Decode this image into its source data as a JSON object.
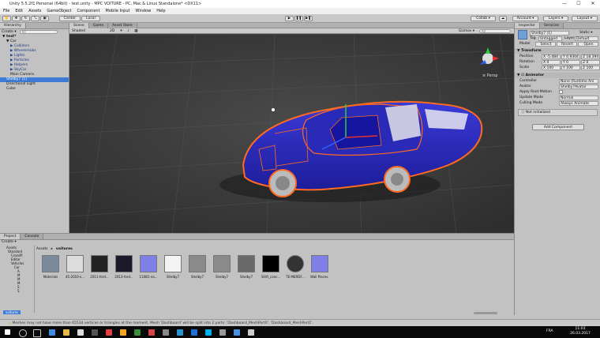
{
  "window": {
    "title": "Unity 5.5.2f1 Personal (64bit) - test.unity - MPC VOITURE - PC, Mac & Linux Standalone* <DX11>",
    "controls": [
      "—",
      "☐",
      "✕"
    ]
  },
  "menu": [
    "File",
    "Edit",
    "Assets",
    "GameObject",
    "Component",
    "Mobile Input",
    "Window",
    "Help"
  ],
  "toolbar": {
    "center": "Center",
    "local": "Local",
    "collab": "Collab ▾",
    "account": "Account ▾",
    "layers": "Layers ▾",
    "layout": "Layout ▾",
    "play": "▶",
    "pause": "❚❚",
    "step": "▶❚"
  },
  "hierarchy": {
    "tab": "Hierarchy",
    "create": "Create ▾",
    "search_placeholder": "All",
    "scene": "test*",
    "items": [
      "▼ Car",
      "▶ Colliders",
      "▶ WheelsHubs",
      "▶ Lights",
      "▶ Particles",
      "▶ Helpers",
      "▶ SkyCar",
      "Main Camera",
      "Shelby7 (1)",
      "Directional Light",
      "Cube"
    ]
  },
  "scene": {
    "tabs": [
      "Scene",
      "Game",
      "Asset Store"
    ],
    "shading": "Shaded",
    "mode": "2D",
    "gizmos": "Gizmos ▾",
    "search": "All",
    "persp": "≡ Persp"
  },
  "inspector": {
    "tabs": [
      "Inspector",
      "Services"
    ],
    "object_name": "Shelby7 (1)",
    "static": "Static ▾",
    "tag_label": "Tag",
    "tag": "Untagged",
    "layer_label": "Layer",
    "layer": "Default",
    "prefab_label": "Model",
    "prefab_buttons": [
      "Select",
      "Revert",
      "Open"
    ],
    "transform": {
      "title": "Transform",
      "position_label": "Position",
      "rotation_label": "Rotation",
      "scale_label": "Scale",
      "position": [
        "X -5.484",
        "Y 0.9304",
        "Z 18.394"
      ],
      "rotation": [
        "X 0",
        "Y 0",
        "Z 0"
      ],
      "scale": [
        "X 100",
        "Y 100",
        "Z 100"
      ]
    },
    "animator": {
      "title": "Animator",
      "rows": [
        [
          "Controller",
          "None (Runtime Ani"
        ],
        [
          "Avatar",
          "Shelby7Avatar"
        ],
        [
          "Apply Root Motion",
          ""
        ],
        [
          "Update Mode",
          "Normal"
        ],
        [
          "Culling Mode",
          "Always Animate"
        ]
      ],
      "message": "Not initialized"
    },
    "add_component": "Add Component"
  },
  "project": {
    "tabs": [
      "Project",
      "Console"
    ],
    "create": "Create ▾",
    "breadcrumb": [
      "Assets",
      "voitures"
    ],
    "tree": [
      "Assets",
      "Standard",
      "CrossPl",
      "Editor",
      "Vehicles",
      "Car",
      "A",
      "M",
      "M",
      "M",
      "S",
      "S"
    ],
    "assets": [
      {
        "name": "Materials",
        "kind": "folder"
      },
      {
        "name": "45-2010-s...",
        "kind": "tex1"
      },
      {
        "name": "2011-ford...",
        "kind": "tex2"
      },
      {
        "name": "2013-ford...",
        "kind": "tex3"
      },
      {
        "name": "11081-na...",
        "kind": "mat"
      },
      {
        "name": "Shelby7",
        "kind": "file"
      },
      {
        "name": "Shelby7",
        "kind": "model"
      },
      {
        "name": "Shelby7",
        "kind": "model"
      },
      {
        "name": "Shelby7",
        "kind": "model2"
      },
      {
        "name": "Shift_conc...",
        "kind": "black"
      },
      {
        "name": "TE-MERDF...",
        "kind": "dark"
      },
      {
        "name": "Wall Pieces...",
        "kind": "mat"
      }
    ],
    "bottom_label": "voitures"
  },
  "status": "Meshes may not have more than 65534 vertices or triangles at the moment. Mesh 'Dashboard' will be split into 2 parts: 'Dashboard_MeshPart0', 'Dashboard_MeshPart1'.",
  "taskbar": {
    "lang": "FRA",
    "time": "11:03",
    "date": "26.03.2017"
  }
}
